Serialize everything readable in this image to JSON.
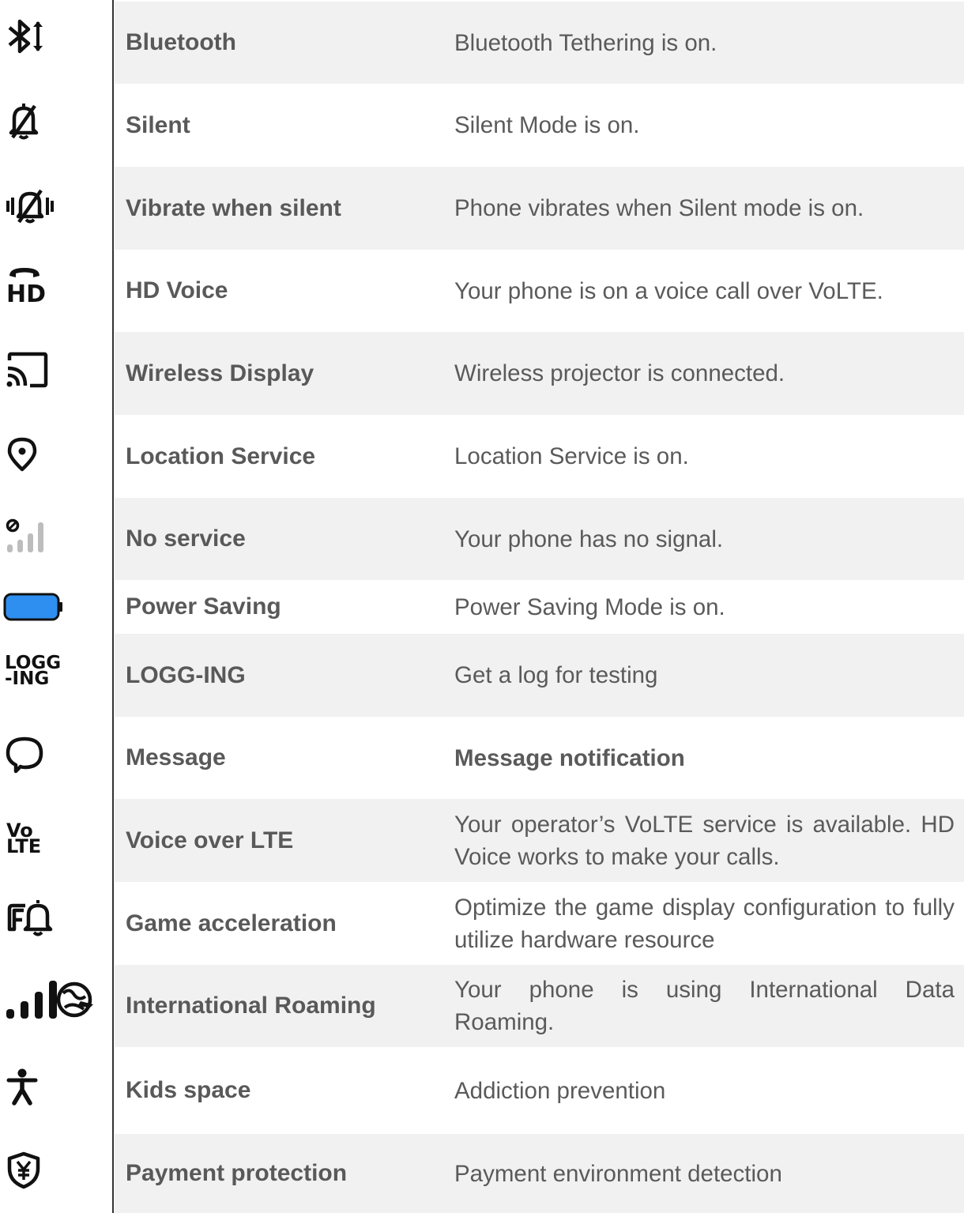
{
  "rows": [
    {
      "name": "Bluetooth",
      "desc": "Bluetooth Tethering is on.",
      "icon": "bluetooth-tethering-icon",
      "shaded": true
    },
    {
      "name": "Silent",
      "desc": "Silent Mode is on.",
      "icon": "bell-off-icon",
      "shaded": false
    },
    {
      "name": "Vibrate when silent",
      "desc": "Phone vibrates when Silent mode is on.",
      "icon": "vibrate-bell-off-icon",
      "shaded": true
    },
    {
      "name": "HD Voice",
      "desc": "Your phone is on a voice call over VoLTE.",
      "icon": "hd-voice-icon",
      "icon_text": "HD",
      "shaded": false
    },
    {
      "name": "Wireless Display",
      "desc": "Wireless projector is connected.",
      "icon": "cast-icon",
      "shaded": true
    },
    {
      "name": "Location Service",
      "desc": "Location Service is on.",
      "icon": "location-pin-icon",
      "shaded": false
    },
    {
      "name": "No service",
      "desc": "Your phone has no signal.",
      "icon": "no-signal-icon",
      "shaded": true
    },
    {
      "name": "Power Saving",
      "desc": "Power Saving Mode is on.",
      "icon": "battery-icon",
      "shaded": false,
      "accent": "#2f8ff0"
    },
    {
      "name": "LOGG-ING",
      "desc": "Get a log for testing",
      "icon": "logging-icon",
      "icon_text_1": "LOGG",
      "icon_text_2": "-ING",
      "shaded": true
    },
    {
      "name": "Message",
      "desc": "Message notification",
      "icon": "message-bubble-icon",
      "shaded": false,
      "desc_bold": true
    },
    {
      "name": "Voice over LTE",
      "desc": "Your operator’s VoLTE service is available. HD Voice works to make your calls.",
      "icon": "volte-icon",
      "icon_text_1": "Vo",
      "icon_text_2": "LTE",
      "shaded": true
    },
    {
      "name": "Game acceleration",
      "desc": "Optimize the game display configuration to fully utilize hardware resource",
      "icon": "game-acceleration-icon",
      "shaded": false
    },
    {
      "name": "International Roaming",
      "desc": "Your phone is using International Data Roaming.",
      "icon": "roaming-signal-icon",
      "shaded": true
    },
    {
      "name": "Kids space",
      "desc": "Addiction prevention",
      "icon": "kid-icon",
      "shaded": false
    },
    {
      "name": "Payment protection",
      "desc": "Payment environment detection",
      "icon": "yuan-shield-icon",
      "shaded": true
    }
  ]
}
